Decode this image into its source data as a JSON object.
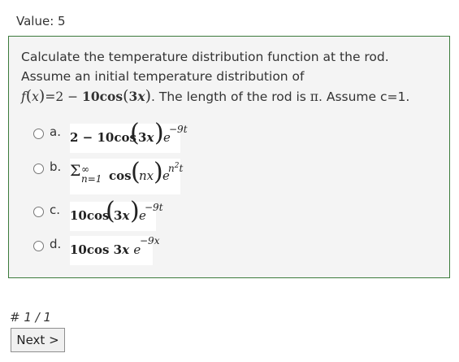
{
  "value_label": "Value: 5",
  "question": {
    "text_part1": "Calculate the temperature distribution function at the rod. Assume an initial temperature distribution of",
    "formula": "f(x) = 2 − 10cos(3x)",
    "text_part2": ". The length of the rod is",
    "pi": "π",
    "text_part3": ". Assume c=1."
  },
  "options": [
    {
      "letter": "a.",
      "formula": "2 − 10cos(3x) e^(−9t)"
    },
    {
      "letter": "b.",
      "formula": "Σ_(n=1)^∞ cos(nx) e^(n²t)"
    },
    {
      "letter": "c.",
      "formula": "10cos(3x) e^(−9t)"
    },
    {
      "letter": "d.",
      "formula": "10cos 3x e^(−9x)"
    }
  ],
  "footer": {
    "page_counter": "# 1 / 1",
    "next_label": "Next >"
  }
}
